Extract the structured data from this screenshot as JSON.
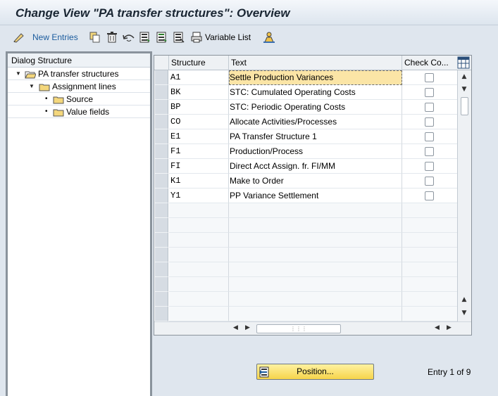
{
  "window": {
    "title": "Change View \"PA transfer structures\": Overview"
  },
  "toolbar": {
    "new_entries_label": "New Entries",
    "variable_list_label": "Variable List"
  },
  "dialog_structure": {
    "header": "Dialog Structure",
    "items": [
      {
        "label": "PA transfer structures",
        "level": 0,
        "expanded": true,
        "icon": "open-folder-icon"
      },
      {
        "label": "Assignment lines",
        "level": 1,
        "expanded": true,
        "icon": "folder-icon"
      },
      {
        "label": "Source",
        "level": 2,
        "icon": "folder-icon"
      },
      {
        "label": "Value fields",
        "level": 2,
        "icon": "folder-icon"
      }
    ]
  },
  "table": {
    "columns": [
      "Structure",
      "Text",
      "Check Co..."
    ],
    "rows": [
      {
        "structure": "A1",
        "text": "Settle Production Variances",
        "checked": false
      },
      {
        "structure": "BK",
        "text": "STC: Cumulated Operating Costs",
        "checked": false
      },
      {
        "structure": "BP",
        "text": "STC: Periodic Operating Costs",
        "checked": false
      },
      {
        "structure": "CO",
        "text": "Allocate Activities/Processes",
        "checked": false
      },
      {
        "structure": "E1",
        "text": "PA Transfer Structure 1",
        "checked": false
      },
      {
        "structure": "F1",
        "text": "Production/Process",
        "checked": false
      },
      {
        "structure": "FI",
        "text": "Direct Acct Assign. fr. FI/MM",
        "checked": false
      },
      {
        "structure": "K1",
        "text": "Make to Order",
        "checked": false
      },
      {
        "structure": "Y1",
        "text": "PP Variance Settlement",
        "checked": false
      }
    ]
  },
  "footer": {
    "position_button_label": "Position...",
    "entry_text": "Entry 1 of 9"
  },
  "colors": {
    "focus_cell": "#fbe5a6",
    "position_button": "#f6d44b",
    "background": "#dfe6ee"
  }
}
